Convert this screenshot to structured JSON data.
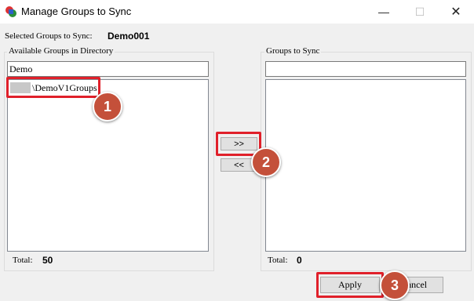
{
  "window": {
    "title": "Manage Groups to Sync",
    "minimize_glyph": "—",
    "maximize_glyph": "☐",
    "close_glyph": "✕"
  },
  "selected": {
    "label": "Selected Groups to Sync:",
    "value": "Demo001"
  },
  "available": {
    "group_label": "Available Groups in Directory",
    "filter_value": "Demo",
    "items": [
      {
        "label": "\\DemoV1Groups"
      }
    ],
    "total_label": "Total:",
    "total_value": "50"
  },
  "sync": {
    "group_label": "Groups to Sync",
    "filter_value": "",
    "total_label": "Total:",
    "total_value": "0"
  },
  "buttons": {
    "add": ">>",
    "remove": "<<",
    "apply": "Apply",
    "cancel": "Cancel"
  },
  "annotations": [
    {
      "number": "1"
    },
    {
      "number": "2"
    },
    {
      "number": "3"
    }
  ],
  "colors": {
    "highlight": "#e0202a",
    "step_badge": "#c4503a"
  }
}
